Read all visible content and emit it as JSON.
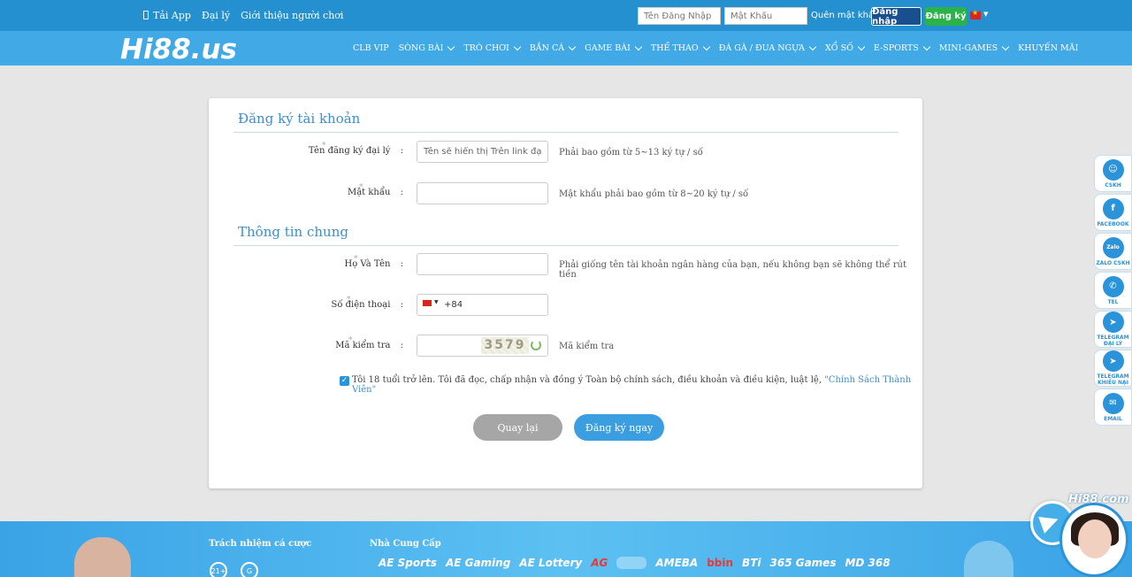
{
  "topbar": {
    "app_label": "Tải App",
    "agent_label": "Đại lý",
    "referral_label": "Giới thiệu người chơi",
    "username_placeholder": "Tên Đăng Nhập",
    "password_placeholder": "Mật Khẩu",
    "forgot_label": "Quên mật khẩu?",
    "login_label": "Đăng nhập",
    "register_label": "Đăng ký"
  },
  "brand": {
    "logo_text": "Hi88.us"
  },
  "nav": {
    "items": [
      {
        "label": "CLB VIP",
        "dropdown": false
      },
      {
        "label": "SÒNG BÀI",
        "dropdown": true
      },
      {
        "label": "TRÒ CHƠI",
        "dropdown": true
      },
      {
        "label": "BẮN CÁ",
        "dropdown": true
      },
      {
        "label": "GAME BÀI",
        "dropdown": true
      },
      {
        "label": "THỂ THAO",
        "dropdown": true
      },
      {
        "label": "ĐÁ GÀ / ĐUA NGỰA",
        "dropdown": true
      },
      {
        "label": "XỔ SỐ",
        "dropdown": true
      },
      {
        "label": "E-SPORTS",
        "dropdown": true
      },
      {
        "label": "MINI-GAMES",
        "dropdown": true
      },
      {
        "label": "KHUYẾN MÃI",
        "dropdown": false
      }
    ]
  },
  "form": {
    "section_account": "Đăng ký tài khoản",
    "section_general": "Thông tin chung",
    "agent_name_label": "Tên đăng ký đại lý",
    "agent_name_placeholder": "Tên sẽ hiển thị Trên link đại lý vi",
    "agent_name_hint": "Phải bao gồm từ 5~13 ký tự / số",
    "password_label": "Mật khẩu",
    "password_hint": "Mật khẩu phải bao gồm từ 8~20 ký tự / số",
    "fullname_label": "Họ Và Tên",
    "fullname_hint": "Phải giống tên tài khoản ngân hàng của bạn, nếu không bạn sẽ không thể rút tiền",
    "phone_label": "Số điện thoại",
    "phone_code": "+84",
    "captcha_label": "Mã kiểm tra",
    "captcha_code": "3579",
    "captcha_hint": "Mã kiểm tra",
    "colon": ":",
    "agree_text": "Tôi 18 tuổi trở lên. Tôi đã đọc, chấp nhận và đồng ý Toàn bộ chính sách, điều khoản và điều kiện, luật lệ,",
    "agree_link": "\"Chính Sách Thành Viên\"",
    "checkbox_checked": true,
    "back_label": "Quay lại",
    "submit_label": "Đăng ký ngay"
  },
  "sidebar": {
    "items": [
      {
        "label": "CSKH",
        "icon": "support-agent-icon",
        "glyph": "☺"
      },
      {
        "label": "FACEBOOK",
        "icon": "facebook-icon",
        "glyph": "f"
      },
      {
        "label": "ZALO CSKH",
        "icon": "zalo-icon",
        "glyph": "Zalo"
      },
      {
        "label": "TEL",
        "icon": "phone-icon",
        "glyph": "✆"
      },
      {
        "label": "TELEGRAM ĐẠI LÝ",
        "icon": "telegram-icon",
        "glyph": "➤"
      },
      {
        "label": "TELEGRAM KHIẾU NẠI",
        "icon": "telegram-icon",
        "glyph": "➤"
      },
      {
        "label": "EMAIL",
        "icon": "email-icon",
        "glyph": "✉"
      }
    ]
  },
  "footer": {
    "responsibility_title": "Trách nhiệm cá cược",
    "age_badge": "21+",
    "providers_title": "Nhà Cung Cấp",
    "providers": [
      "AE Sports",
      "AE Gaming",
      "AE Lottery",
      "AG",
      "",
      "AMEBA",
      "bbin",
      "BTi",
      "365 Games",
      "MD 368"
    ]
  },
  "chat": {
    "brand": "Hi88.com"
  },
  "colors": {
    "topbar": "#2490cf",
    "navbar": "#41a9e6",
    "accent": "#3a8fcf",
    "register_green": "#2bb34a",
    "login_navy": "#1a4f8f"
  }
}
